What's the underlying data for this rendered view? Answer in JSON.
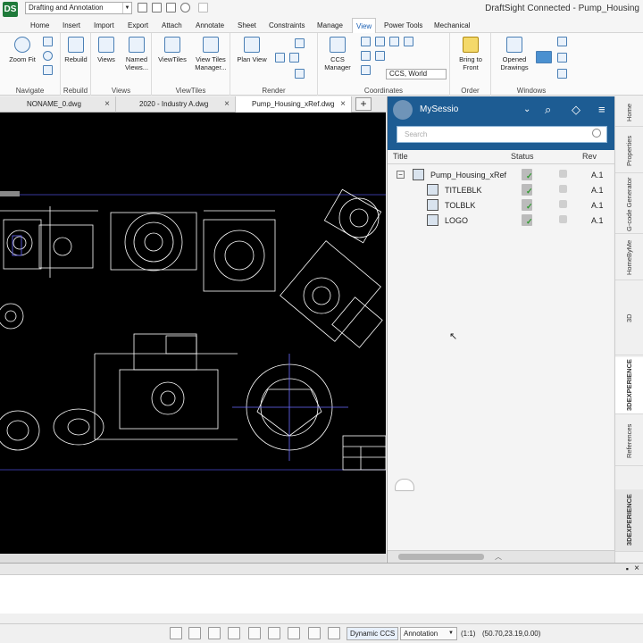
{
  "titlebar": {
    "workspace": "Drafting and Annotation",
    "title": "DraftSight Connected - Pump_Housing",
    "logo_text": "DS"
  },
  "menu": {
    "items": [
      "Home",
      "Insert",
      "Import",
      "Export",
      "Attach",
      "Annotate",
      "Sheet",
      "Constraints",
      "Manage",
      "View",
      "Power Tools",
      "Mechanical"
    ],
    "active": "View"
  },
  "ribbon": {
    "groups": {
      "navigate": "Navigate",
      "rebuild": "Rebuild",
      "views": "Views",
      "viewtiles": "ViewTiles",
      "render": "Render",
      "coordinates": "Coordinates",
      "order": "Order",
      "windows": "Windows"
    },
    "buttons": {
      "zoom_fit": "Zoom Fit",
      "rebuild": "Rebuild",
      "views": "Views",
      "named_views": "Named Views...",
      "viewtiles": "ViewTiles",
      "view_tiles_manager": "View Tiles Manager...",
      "plan_view": "Plan View",
      "ccs_manager": "CCS Manager",
      "bring_to_front": "Bring to Front",
      "opened_drawings": "Opened Drawings"
    },
    "ccs_select": "CCS, World"
  },
  "doctabs": {
    "tabs": [
      "NONAME_0.dwg",
      "2020 - Industry A.dwg",
      "Pump_Housing_xRef.dwg"
    ],
    "active": "Pump_Housing_xRef.dwg"
  },
  "panel": {
    "title": "MySessio",
    "search_placeholder": "Search",
    "columns": {
      "title": "Title",
      "status": "Status",
      "rev": "Rev"
    },
    "tree": [
      {
        "name": "Pump_Housing_xRef",
        "rev": "A.1",
        "level": 0
      },
      {
        "name": "TITLEBLK",
        "rev": "A.1",
        "level": 1
      },
      {
        "name": "TOLBLK",
        "rev": "A.1",
        "level": 1
      },
      {
        "name": "LOGO",
        "rev": "A.1",
        "level": 1
      }
    ]
  },
  "sidetabs": [
    "Home",
    "Properties",
    "G-code Generator",
    "HomeByMe",
    "3D CONTENTCENTRAL",
    "3DEXPERIENCE",
    "References"
  ],
  "sidetab_footer": "3DEXPERIENCE",
  "statusbar": {
    "dynamic_ccs": "Dynamic CCS",
    "annotation": "Annotation",
    "scale": "(1:1)",
    "coords": "(50.70,23.19,0.00)"
  },
  "colors": {
    "accent": "#1d5c93",
    "canvas": "#000000",
    "drawing_lines": "#ffffff"
  }
}
